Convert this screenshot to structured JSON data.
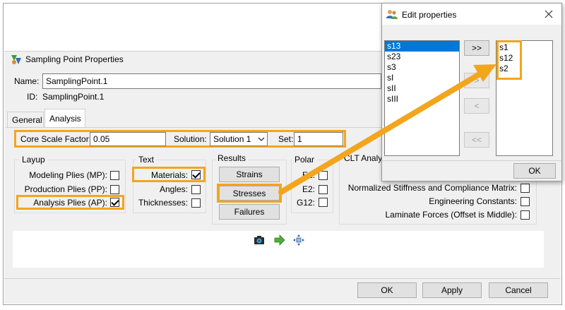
{
  "main": {
    "window_title": "Sampling Point Properties",
    "name_label": "Name:",
    "name_value": "SamplingPoint.1",
    "id_label": "ID:",
    "id_value": "SamplingPoint.1",
    "tabs": [
      {
        "label": "General",
        "active": false
      },
      {
        "label": "Analysis",
        "active": true
      }
    ],
    "core_scale_label": "Core Scale Factor:",
    "core_scale_value": "0.05",
    "solution_label": "Solution:",
    "solution_value": "Solution 1",
    "set_label": "Set:",
    "set_value": "1",
    "layup": {
      "title": "Layup",
      "items": [
        {
          "label": "Modeling Plies (MP):",
          "checked": false
        },
        {
          "label": "Production Plies (PP):",
          "checked": false
        },
        {
          "label": "Analysis Plies (AP):",
          "checked": true
        }
      ]
    },
    "text": {
      "title": "Text",
      "items": [
        {
          "label": "Materials:",
          "checked": true
        },
        {
          "label": "Angles:",
          "checked": false
        },
        {
          "label": "Thicknesses:",
          "checked": false
        }
      ]
    },
    "results": {
      "title": "Results",
      "buttons": [
        "Strains",
        "Stresses",
        "Failures"
      ]
    },
    "polar": {
      "title": "Polar",
      "items": [
        {
          "label": "E1:",
          "checked": false
        },
        {
          "label": "E2:",
          "checked": false
        },
        {
          "label": "G12:",
          "checked": false
        }
      ]
    },
    "clt": {
      "title": "CLT Analysis",
      "items": [
        {
          "label": "Normalized Stiffness and Compliance Matrix:",
          "checked": false
        },
        {
          "label": "Engineering Constants:",
          "checked": false
        },
        {
          "label": "Laminate Forces (Offset is Middle):",
          "checked": false
        }
      ]
    },
    "footer": {
      "ok": "OK",
      "apply": "Apply",
      "cancel": "Cancel"
    }
  },
  "dialog": {
    "title": "Edit properties",
    "available": [
      "s13",
      "s23",
      "s3",
      "sI",
      "sII",
      "sIII"
    ],
    "selected_available": "s13",
    "chosen": [
      "s1",
      "s12",
      "s2"
    ],
    "buttons": {
      "add_all": ">>",
      "add": ">",
      "remove": "<",
      "remove_all": "<<"
    },
    "ok": "OK"
  },
  "colors": {
    "highlight": "#f3a51c",
    "arrow": "#f3a51c",
    "selection": "#0078d7"
  }
}
